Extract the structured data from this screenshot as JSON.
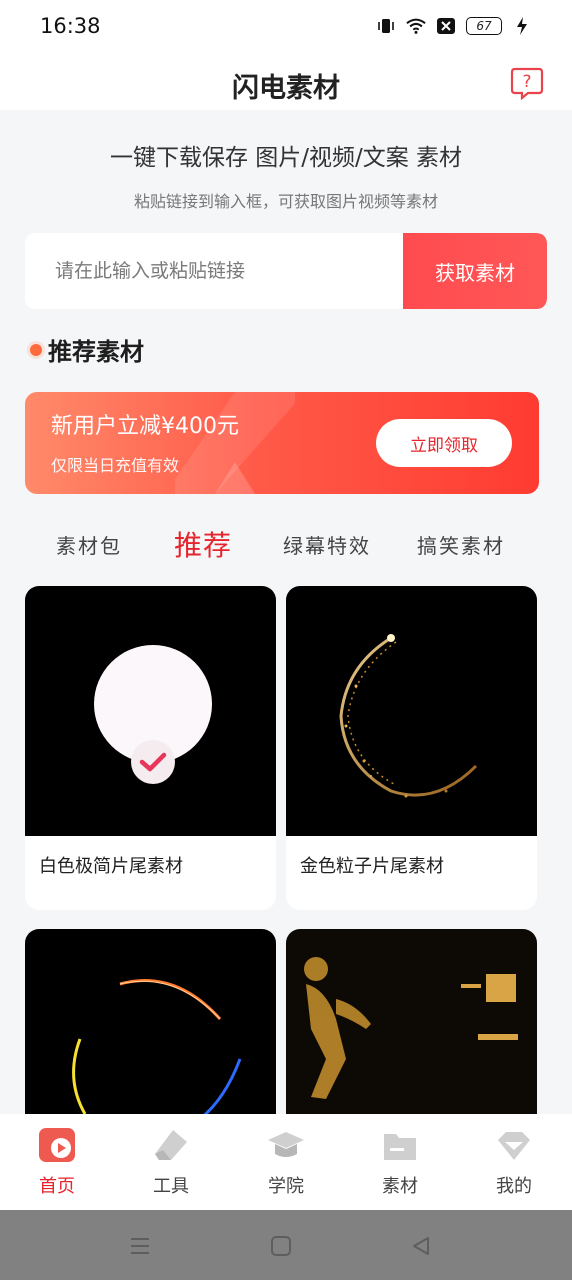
{
  "status": {
    "time": "16:38",
    "battery": "67"
  },
  "header": {
    "title": "闪电素材",
    "help_icon": "question-icon"
  },
  "hero": {
    "slogan": "一键下载保存 图片/视频/文案 素材",
    "subtitle": "粘贴链接到输入框，可获取图片视频等素材"
  },
  "link_input": {
    "placeholder": "请在此输入或粘贴链接",
    "value": "",
    "button": "获取素材"
  },
  "section": {
    "title": "推荐素材"
  },
  "promo": {
    "title": "新用户立减¥400元",
    "subtitle": "仅限当日充值有效",
    "button": "立即领取"
  },
  "tabs": [
    {
      "label": "素材包",
      "active": false
    },
    {
      "label": "推荐",
      "active": true
    },
    {
      "label": "绿幕特效",
      "active": false
    },
    {
      "label": "搞笑素材",
      "active": false
    }
  ],
  "cards": [
    {
      "title": "白色极简片尾素材"
    },
    {
      "title": "金色粒子片尾素材"
    },
    {
      "title": ""
    },
    {
      "title": ""
    }
  ],
  "bottom_nav": [
    {
      "label": "首页",
      "icon": "home-play-icon",
      "active": true
    },
    {
      "label": "工具",
      "icon": "eraser-icon",
      "active": false
    },
    {
      "label": "学院",
      "icon": "graduation-cap-icon",
      "active": false
    },
    {
      "label": "素材",
      "icon": "folder-icon",
      "active": false
    },
    {
      "label": "我的",
      "icon": "diamond-icon",
      "active": false
    }
  ],
  "colors": {
    "accent": "#e6242c",
    "brand_red": "#ff4b4f",
    "promo_start": "#ff8a6a",
    "promo_end": "#ff3b31"
  }
}
